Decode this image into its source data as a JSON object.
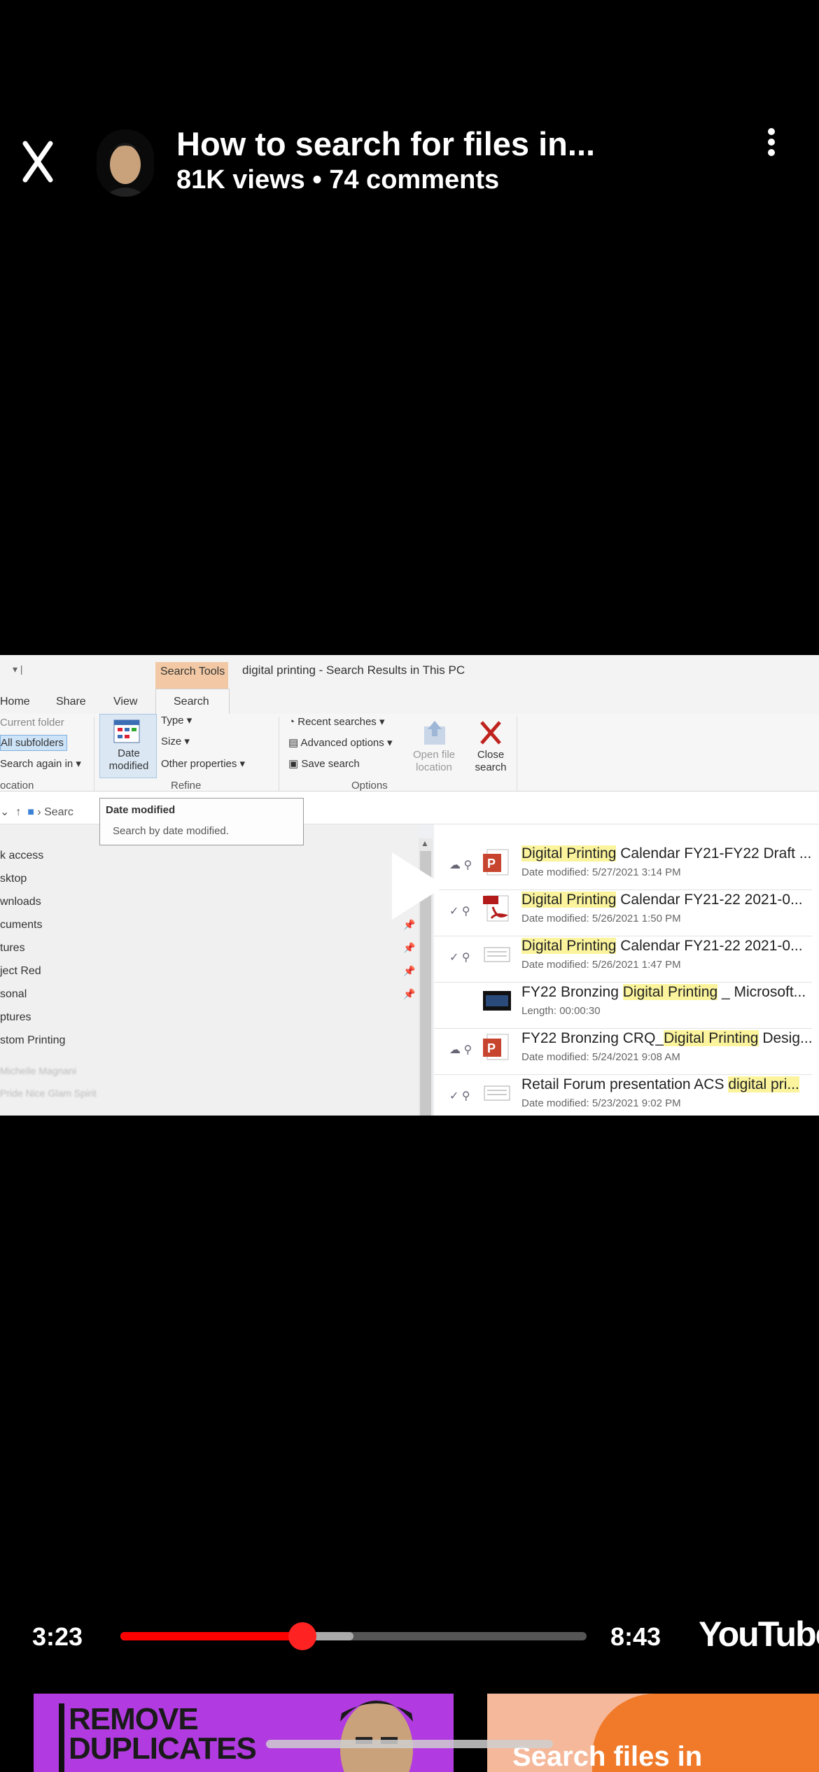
{
  "header": {
    "title": "How to search for files in...",
    "views": "81K views",
    "separator": "•",
    "comments": "74 comments",
    "close_icon": "close-icon",
    "more_icon": "more-vert-icon"
  },
  "video_frame": {
    "window_title": "digital printing - Search Results in This PC",
    "context_tab": "Search Tools",
    "tabs": [
      "Home",
      "Share",
      "View",
      "Search"
    ],
    "location_group": {
      "current_folder": "Current folder",
      "all_subfolders": "All subfolders",
      "search_again": "Search again in",
      "group_label": "ocation"
    },
    "refine_group": {
      "date_modified": "Date modified",
      "type": "Type",
      "size": "Size",
      "other_properties": "Other properties",
      "group_label": "Refine"
    },
    "options_group": {
      "recent_searches": "Recent searches",
      "advanced_options": "Advanced options",
      "save_search": "Save search",
      "open_file_location": "Open file location",
      "close_search": "Close search",
      "group_label": "Options"
    },
    "tooltip": {
      "title": "Date modified",
      "body": "Search by date modified."
    },
    "address_text": "Searc",
    "nav_items": [
      "k access",
      "sktop",
      "wnloads",
      "cuments",
      "tures",
      "ject Red",
      "sonal",
      "ptures",
      "stom Printing"
    ],
    "results": [
      {
        "pre": "",
        "hl": "Digital Printing",
        "post": " Calendar FY21-FY22 Draft ...",
        "sub": "Date modified: 5/27/2021 3:14 PM",
        "icon": "powerpoint-icon"
      },
      {
        "pre": "",
        "hl": "Digital Printing",
        "post": " Calendar FY21-22 2021-0...",
        "sub": "Date modified: 5/26/2021 1:50 PM",
        "icon": "pdf-icon"
      },
      {
        "pre": "",
        "hl": "Digital Printing",
        "post": " Calendar FY21-22 2021-0...",
        "sub": "Date modified: 5/26/2021 1:47 PM",
        "icon": "document-icon"
      },
      {
        "pre": "FY22 Bronzing ",
        "hl": "Digital Printing",
        "post": " _ Microsoft...",
        "sub": "Length: 00:00:30",
        "icon": "video-icon"
      },
      {
        "pre": "FY22 Bronzing CRQ_",
        "hl": "Digital Printing",
        "post": " Desig...",
        "sub": "Date modified: 5/24/2021 9:08 AM",
        "icon": "powerpoint-icon"
      },
      {
        "pre": "Retail Forum presentation ACS ",
        "hl": "digital pri...",
        "post": "",
        "sub": "Date modified: 5/23/2021 9:02 PM",
        "icon": "document-icon"
      }
    ]
  },
  "player": {
    "current_time": "3:23",
    "duration": "8:43",
    "progress_fraction": 0.39,
    "buffered_fraction": 0.5,
    "logo": "YouTube"
  },
  "thumbnails": [
    {
      "text": "REMOVE DUPLICATES"
    },
    {
      "text": "Search files in"
    }
  ],
  "colors": {
    "progress": "#ff0000",
    "highlight": "#fbf49d",
    "search_tools_tab": "#f2c9a4"
  }
}
